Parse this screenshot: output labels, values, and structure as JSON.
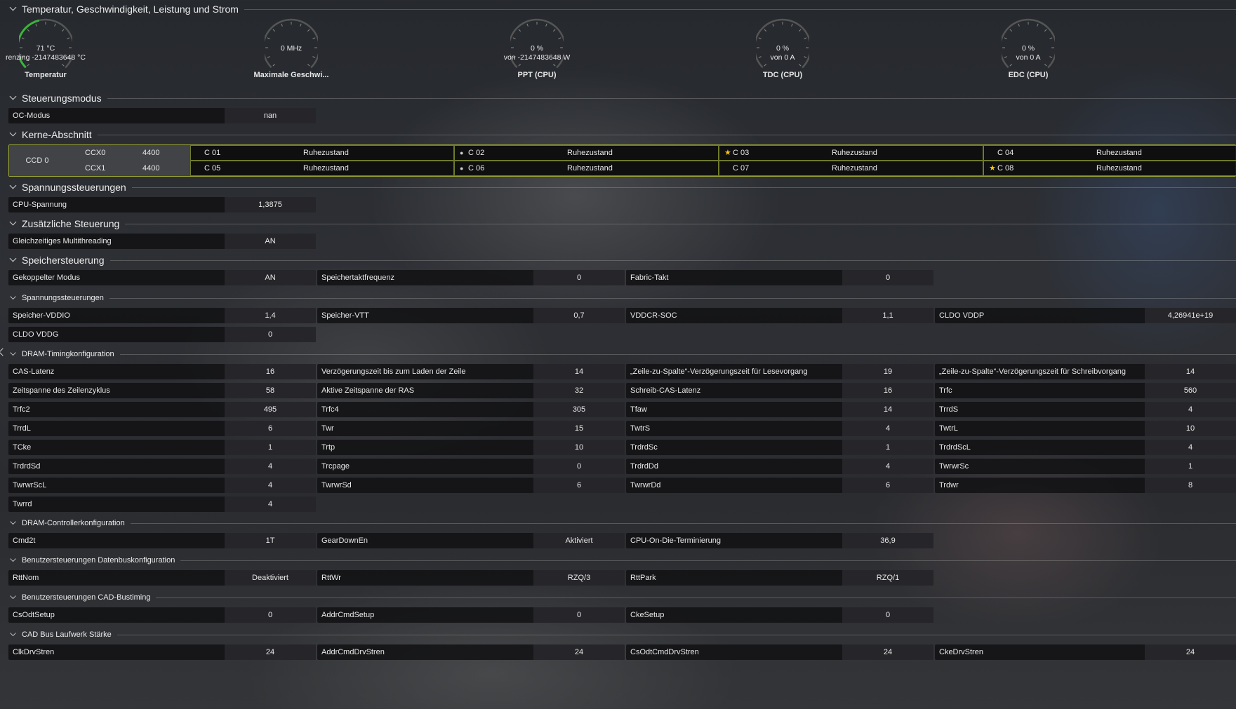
{
  "sections": {
    "temp": "Temperatur, Geschwindigkeit, Leistung und Strom",
    "control": "Steuerungsmodus",
    "cores": "Kerne-Abschnitt",
    "voltage": "Spannungssteuerungen",
    "extra": "Zusätzliche Steuerung",
    "memory": "Speichersteuerung",
    "mem_voltage": "Spannungssteuerungen",
    "dram_timing": "DRAM-Timingkonfiguration",
    "dram_ctrl": "DRAM-Controllerkonfiguration",
    "databus": "Benutzersteuerungen Datenbuskonfiguration",
    "cad": "Benutzersteuerungen CAD-Bustiming",
    "cad_drive": "CAD Bus Laufwerk Stärke"
  },
  "gauges": [
    {
      "line1": "71 °C",
      "line2": "renzing -2147483648 °C",
      "label": "Temperatur",
      "fill": 0.45,
      "color": "#3db33d"
    },
    {
      "line1": "0 MHz",
      "line2": "",
      "label": "Maximale Geschwi...",
      "fill": 0,
      "color": "#3db33d"
    },
    {
      "line1": "0 %",
      "line2": "von -2147483648 W",
      "label": "PPT (CPU)",
      "fill": 0,
      "color": "#3db33d"
    },
    {
      "line1": "0 %",
      "line2": "von 0 A",
      "label": "TDC (CPU)",
      "fill": 0,
      "color": "#3db33d"
    },
    {
      "line1": "0 %",
      "line2": "von 0 A",
      "label": "EDC (CPU)",
      "fill": 0,
      "color": "#3db33d"
    }
  ],
  "oc": {
    "k": "OC-Modus",
    "v": "nan"
  },
  "ccd": {
    "name": "CCD 0",
    "ccx": [
      {
        "name": "CCX0",
        "freq": "4400"
      },
      {
        "name": "CCX1",
        "freq": "4400"
      }
    ]
  },
  "core_list": [
    {
      "name": "C 01",
      "state": "Ruhezustand",
      "mark": ""
    },
    {
      "name": "C 02",
      "state": "Ruhezustand",
      "mark": "dot"
    },
    {
      "name": "C 03",
      "state": "Ruhezustand",
      "mark": "star"
    },
    {
      "name": "C 04",
      "state": "Ruhezustand",
      "mark": ""
    },
    {
      "name": "C 05",
      "state": "Ruhezustand",
      "mark": ""
    },
    {
      "name": "C 06",
      "state": "Ruhezustand",
      "mark": "dot"
    },
    {
      "name": "C 07",
      "state": "Ruhezustand",
      "mark": ""
    },
    {
      "name": "C 08",
      "state": "Ruhezustand",
      "mark": "star"
    }
  ],
  "mark_glyphs": {
    "star": "★",
    "dot": "●"
  },
  "cpu_voltage": {
    "k": "CPU-Spannung",
    "v": "1,3875"
  },
  "smt": {
    "k": "Gleichzeitiges Multithreading",
    "v": "AN"
  },
  "memory": [
    {
      "k": "Gekoppelter Modus",
      "v": "AN"
    },
    {
      "k": "Speichertaktfrequenz",
      "v": "0"
    },
    {
      "k": "Fabric-Takt",
      "v": "0"
    }
  ],
  "mem_voltage": [
    {
      "k": "Speicher-VDDIO",
      "v": "1,4"
    },
    {
      "k": "Speicher-VTT",
      "v": "0,7"
    },
    {
      "k": "VDDCR-SOC",
      "v": "1,1"
    },
    {
      "k": "CLDO VDDP",
      "v": "4,26941e+19"
    },
    {
      "k": "CLDO VDDG",
      "v": "0"
    }
  ],
  "dram_timing": [
    {
      "k": "CAS-Latenz",
      "v": "16"
    },
    {
      "k": "Verzögerungszeit bis zum Laden der Zeile",
      "v": "14"
    },
    {
      "k": "„Zeile-zu-Spalte“-Verzögerungszeit für Lesevorgang",
      "v": "19"
    },
    {
      "k": "„Zeile-zu-Spalte“-Verzögerungszeit für Schreibvorgang",
      "v": "14"
    },
    {
      "k": "Zeitspanne des Zeilenzyklus",
      "v": "58"
    },
    {
      "k": "Aktive Zeitspanne der RAS",
      "v": "32"
    },
    {
      "k": "Schreib-CAS-Latenz",
      "v": "16"
    },
    {
      "k": "Trfc",
      "v": "560"
    },
    {
      "k": "Trfc2",
      "v": "495"
    },
    {
      "k": "Trfc4",
      "v": "305"
    },
    {
      "k": "Tfaw",
      "v": "14"
    },
    {
      "k": "TrrdS",
      "v": "4"
    },
    {
      "k": "TrrdL",
      "v": "6"
    },
    {
      "k": "Twr",
      "v": "15"
    },
    {
      "k": "TwtrS",
      "v": "4"
    },
    {
      "k": "TwtrL",
      "v": "10"
    },
    {
      "k": "TCke",
      "v": "1"
    },
    {
      "k": "Trtp",
      "v": "10"
    },
    {
      "k": "TrdrdSc",
      "v": "1"
    },
    {
      "k": "TrdrdScL",
      "v": "4"
    },
    {
      "k": "TrdrdSd",
      "v": "4"
    },
    {
      "k": "Trcpage",
      "v": "0"
    },
    {
      "k": "TrdrdDd",
      "v": "4"
    },
    {
      "k": "TwrwrSc",
      "v": "1"
    },
    {
      "k": "TwrwrScL",
      "v": "4"
    },
    {
      "k": "TwrwrSd",
      "v": "6"
    },
    {
      "k": "TwrwrDd",
      "v": "6"
    },
    {
      "k": "Trdwr",
      "v": "8"
    },
    {
      "k": "Twrrd",
      "v": "4"
    }
  ],
  "dram_ctrl": [
    {
      "k": "Cmd2t",
      "v": "1T"
    },
    {
      "k": "GearDownEn",
      "v": "Aktiviert"
    },
    {
      "k": "CPU-On-Die-Terminierung",
      "v": "36,9"
    }
  ],
  "databus": [
    {
      "k": "RttNom",
      "v": "Deaktiviert"
    },
    {
      "k": "RttWr",
      "v": "RZQ/3"
    },
    {
      "k": "RttPark",
      "v": "RZQ/1"
    }
  ],
  "cad": [
    {
      "k": "CsOdtSetup",
      "v": "0"
    },
    {
      "k": "AddrCmdSetup",
      "v": "0"
    },
    {
      "k": "CkeSetup",
      "v": "0"
    }
  ],
  "cad_drive": [
    {
      "k": "ClkDrvStren",
      "v": "24"
    },
    {
      "k": "AddrCmdDrvStren",
      "v": "24"
    },
    {
      "k": "CsOdtCmdDrvStren",
      "v": "24"
    },
    {
      "k": "CkeDrvStren",
      "v": "24"
    }
  ]
}
